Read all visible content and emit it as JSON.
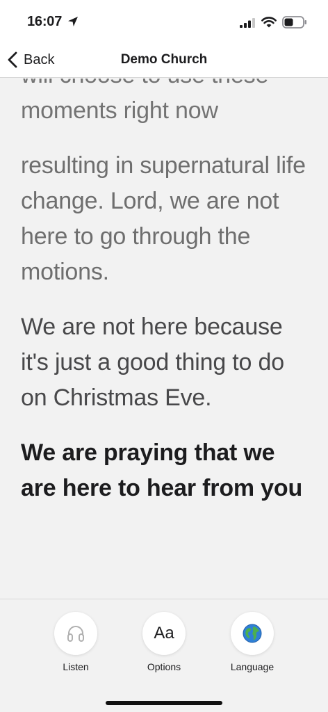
{
  "status_bar": {
    "time": "16:07"
  },
  "nav": {
    "back_label": "Back",
    "title": "Demo Church"
  },
  "transcript": {
    "paragraphs": [
      "will choose to use these moments right now",
      "resulting in supernatural life change. Lord, we are not here to go through the motions.",
      "We are not here because it's just a good thing to do on Christmas Eve.",
      "We are praying that we are here to hear from you"
    ]
  },
  "toolbar": {
    "listen_label": "Listen",
    "options_label": "Options",
    "options_glyph": "Aa",
    "language_label": "Language",
    "language_icon": "globe-icon"
  },
  "colors": {
    "text_primary": "#1c1c1e",
    "text_faded": "#737373",
    "background": "#f2f2f2"
  }
}
